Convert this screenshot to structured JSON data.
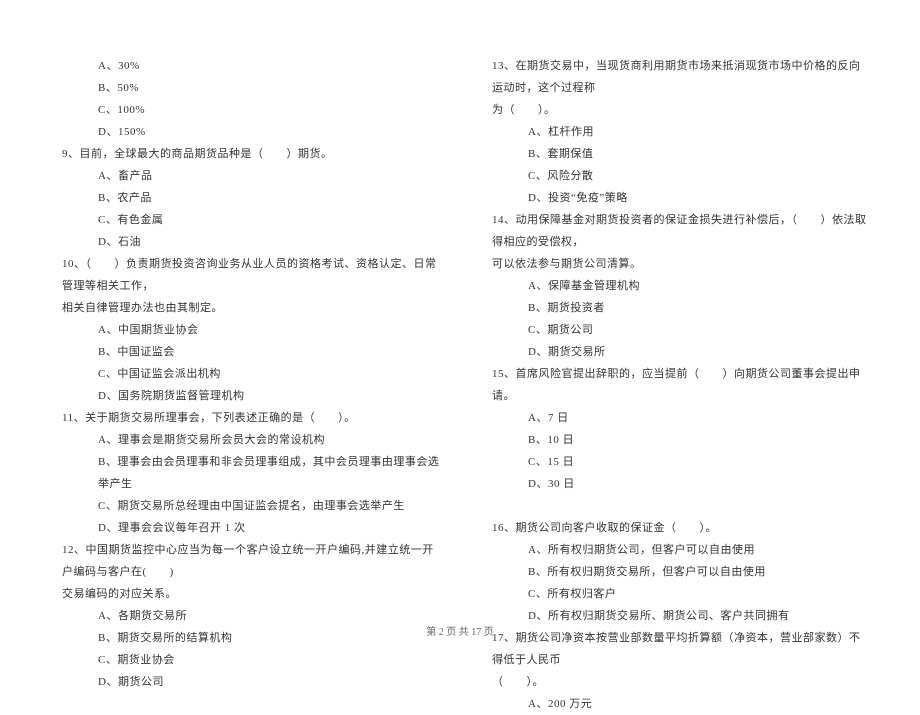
{
  "left": [
    {
      "cls": "indent1",
      "text": "A、30%"
    },
    {
      "cls": "indent1",
      "text": "B、50%"
    },
    {
      "cls": "indent1",
      "text": "C、100%"
    },
    {
      "cls": "indent1",
      "text": "D、150%"
    },
    {
      "cls": "indent0",
      "text": "9、目前，全球最大的商品期货品种是（　　）期货。"
    },
    {
      "cls": "indent1",
      "text": "A、畜产品"
    },
    {
      "cls": "indent1",
      "text": "B、农产品"
    },
    {
      "cls": "indent1",
      "text": "C、有色金属"
    },
    {
      "cls": "indent1",
      "text": "D、石油"
    },
    {
      "cls": "indent0",
      "text": "10、（　　）负责期货投资咨询业务从业人员的资格考试、资格认定、日常管理等相关工作，"
    },
    {
      "cls": "indent0",
      "text": "相关自律管理办法也由其制定。"
    },
    {
      "cls": "indent1",
      "text": "A、中国期货业协会"
    },
    {
      "cls": "indent1",
      "text": "B、中国证监会"
    },
    {
      "cls": "indent1",
      "text": "C、中国证监会派出机构"
    },
    {
      "cls": "indent1",
      "text": "D、国务院期货监督管理机构"
    },
    {
      "cls": "indent0",
      "text": "11、关于期货交易所理事会，下列表述正确的是（　　）。"
    },
    {
      "cls": "indent1",
      "text": "A、理事会是期货交易所会员大会的常设机构"
    },
    {
      "cls": "indent1",
      "text": "B、理事会由会员理事和非会员理事组成，其中会员理事由理事会选举产生"
    },
    {
      "cls": "indent1",
      "text": "C、期货交易所总经理由中国证监会提名，由理事会选举产生"
    },
    {
      "cls": "indent1",
      "text": "D、理事会会议每年召开 1 次"
    },
    {
      "cls": "indent0",
      "text": "12、中国期货监控中心应当为每一个客户设立统一开户编码,并建立统一开户编码与客户在(　　)"
    },
    {
      "cls": "indent0",
      "text": "交易编码的对应关系。"
    },
    {
      "cls": "indent1",
      "text": "A、各期货交易所"
    },
    {
      "cls": "indent1",
      "text": "B、期货交易所的结算机构"
    },
    {
      "cls": "indent1",
      "text": "C、期货业协会"
    },
    {
      "cls": "indent1",
      "text": "D、期货公司"
    }
  ],
  "right": [
    {
      "cls": "indent0",
      "text": "13、在期货交易中，当现货商利用期货市场来抵消现货市场中价格的反向运动时，这个过程称"
    },
    {
      "cls": "indent0",
      "text": "为（　　）。"
    },
    {
      "cls": "indent1",
      "text": "A、杠杆作用"
    },
    {
      "cls": "indent1",
      "text": "B、套期保值"
    },
    {
      "cls": "indent1",
      "text": "C、风险分散"
    },
    {
      "cls": "indent1",
      "text": "D、投资“免疫”策略"
    },
    {
      "cls": "indent0",
      "text": "14、动用保障基金对期货投资者的保证金损失进行补偿后，（　　）依法取得相应的受偿权，"
    },
    {
      "cls": "indent0",
      "text": "可以依法参与期货公司清算。"
    },
    {
      "cls": "indent1",
      "text": "A、保障基金管理机构"
    },
    {
      "cls": "indent1",
      "text": "B、期货投资者"
    },
    {
      "cls": "indent1",
      "text": "C、期货公司"
    },
    {
      "cls": "indent1",
      "text": "D、期货交易所"
    },
    {
      "cls": "indent0",
      "text": "15、首席风险官提出辞职的，应当提前（　　）向期货公司董事会提出申请。"
    },
    {
      "cls": "indent1",
      "text": "A、7 日"
    },
    {
      "cls": "indent1",
      "text": "B、10 日"
    },
    {
      "cls": "indent1",
      "text": "C、15 日"
    },
    {
      "cls": "indent1",
      "text": "D、30 日"
    },
    {
      "cls": "gap",
      "text": ""
    },
    {
      "cls": "indent0",
      "text": "16、期货公司向客户收取的保证金（　　）。"
    },
    {
      "cls": "indent1",
      "text": "A、所有权归期货公司，但客户可以自由使用"
    },
    {
      "cls": "indent1",
      "text": "B、所有权归期货交易所，但客户可以自由使用"
    },
    {
      "cls": "indent1",
      "text": "C、所有权归客户"
    },
    {
      "cls": "indent1",
      "text": "D、所有权归期货交易所、期货公司、客户共同拥有"
    },
    {
      "cls": "indent0",
      "text": "17、期货公司净资本按营业部数量平均折算额（净资本，营业部家数）不得低于人民币"
    },
    {
      "cls": "indent0",
      "text": "（　　）。"
    },
    {
      "cls": "indent1",
      "text": "A、200 万元"
    }
  ],
  "footer": "第 2 页 共 17 页"
}
